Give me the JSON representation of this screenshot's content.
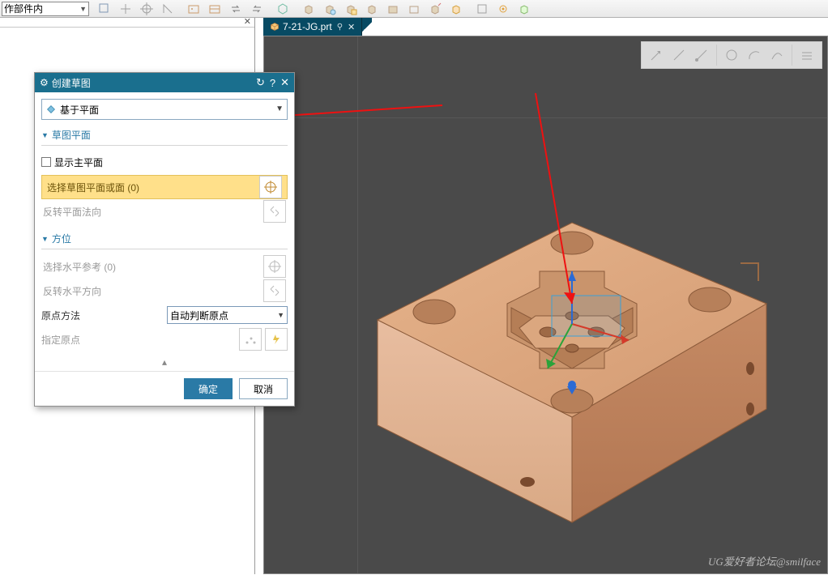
{
  "toolbar": {
    "combo_label": "作部件内"
  },
  "file_tab": {
    "name": "7-21-JG.prt"
  },
  "dialog": {
    "title": "创建草图",
    "type_label": "基于平面",
    "section_plane": "草图平面",
    "show_main_plane": "显示主平面",
    "select_plane": "选择草图平面或面 (0)",
    "reverse_normal": "反转平面法向",
    "section_orient": "方位",
    "select_horiz": "选择水平参考 (0)",
    "reverse_horiz": "反转水平方向",
    "origin_method_label": "原点方法",
    "origin_method_value": "自动判断原点",
    "specify_origin": "指定原点",
    "ok": "确定",
    "cancel": "取消"
  },
  "watermark": "UG爱好者论坛@smilface"
}
